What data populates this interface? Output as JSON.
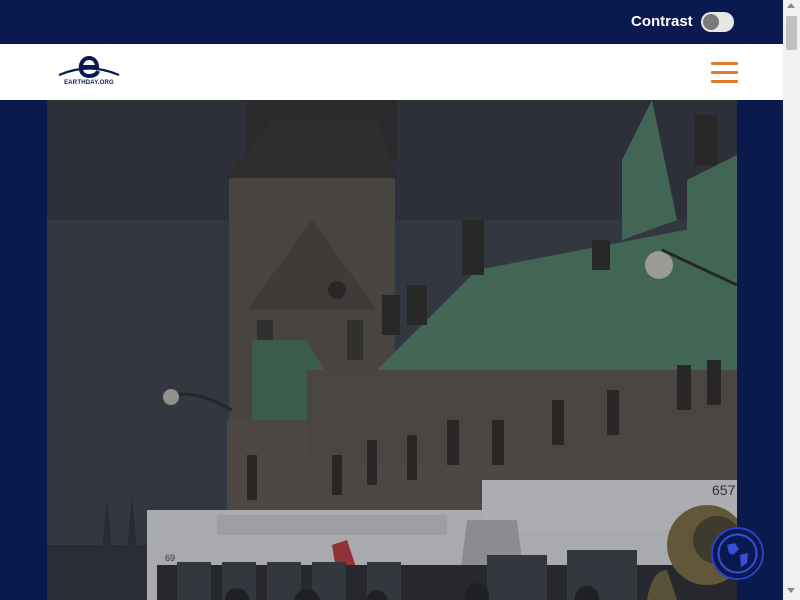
{
  "topbar": {
    "contrast_label": "Contrast",
    "contrast_enabled": false
  },
  "header": {
    "logo_text": "EARTHDAY.ORG",
    "menu_icon": "hamburger-menu-icon"
  },
  "hero": {
    "image_text": {
      "bus_number": "657",
      "bus_route": "69"
    }
  },
  "floating": {
    "globe_icon": "globe-icon"
  },
  "colors": {
    "navy": "#0a1a50",
    "accent_orange": "#e07a2a",
    "roof_green": "#4f7e64"
  }
}
